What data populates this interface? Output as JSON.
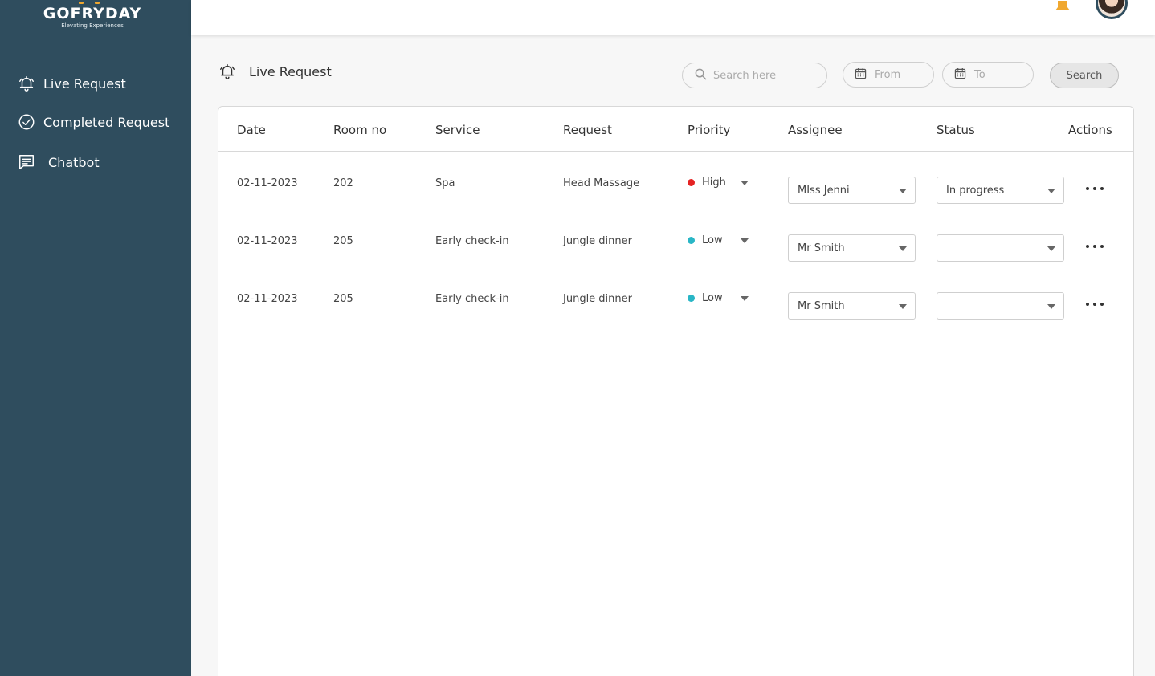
{
  "brand": {
    "name": "GOFRYDAY",
    "tagline": "Elevating Experiences"
  },
  "sidebar": {
    "items": [
      {
        "label": "Live Request",
        "icon": "bell-icon"
      },
      {
        "label": "Completed Request",
        "icon": "check-circle-icon"
      },
      {
        "label": "Chatbot",
        "icon": "chat-icon"
      }
    ]
  },
  "header": {
    "notification_icon": "bell-icon",
    "avatar": "user-avatar"
  },
  "page": {
    "title": "Live Request"
  },
  "toolbar": {
    "search_placeholder": "Search here",
    "from_label": "From",
    "to_label": "To",
    "search_button": "Search"
  },
  "table": {
    "columns": [
      "Date",
      "Room no",
      "Service",
      "Request",
      "Priority",
      "Assignee",
      "Status",
      "Actions"
    ],
    "rows": [
      {
        "date": "02-11-2023",
        "room": "202",
        "service": "Spa",
        "request": "Head Massage",
        "priority": "High",
        "priority_color": "#e52323",
        "assignee": "MIss Jenni",
        "status": "In progress"
      },
      {
        "date": "02-11-2023",
        "room": "205",
        "service": "Early check-in",
        "request": "Jungle dinner",
        "priority": "Low",
        "priority_color": "#29b6c6",
        "assignee": "Mr Smith",
        "status": ""
      },
      {
        "date": "02-11-2023",
        "room": "205",
        "service": "Early check-in",
        "request": "Jungle dinner",
        "priority": "Low",
        "priority_color": "#29b6c6",
        "assignee": "Mr Smith",
        "status": ""
      }
    ]
  },
  "colors": {
    "sidebar_bg": "#2f4d5e",
    "accent_orange": "#f0a830",
    "high": "#e52323",
    "low": "#29b6c6"
  }
}
